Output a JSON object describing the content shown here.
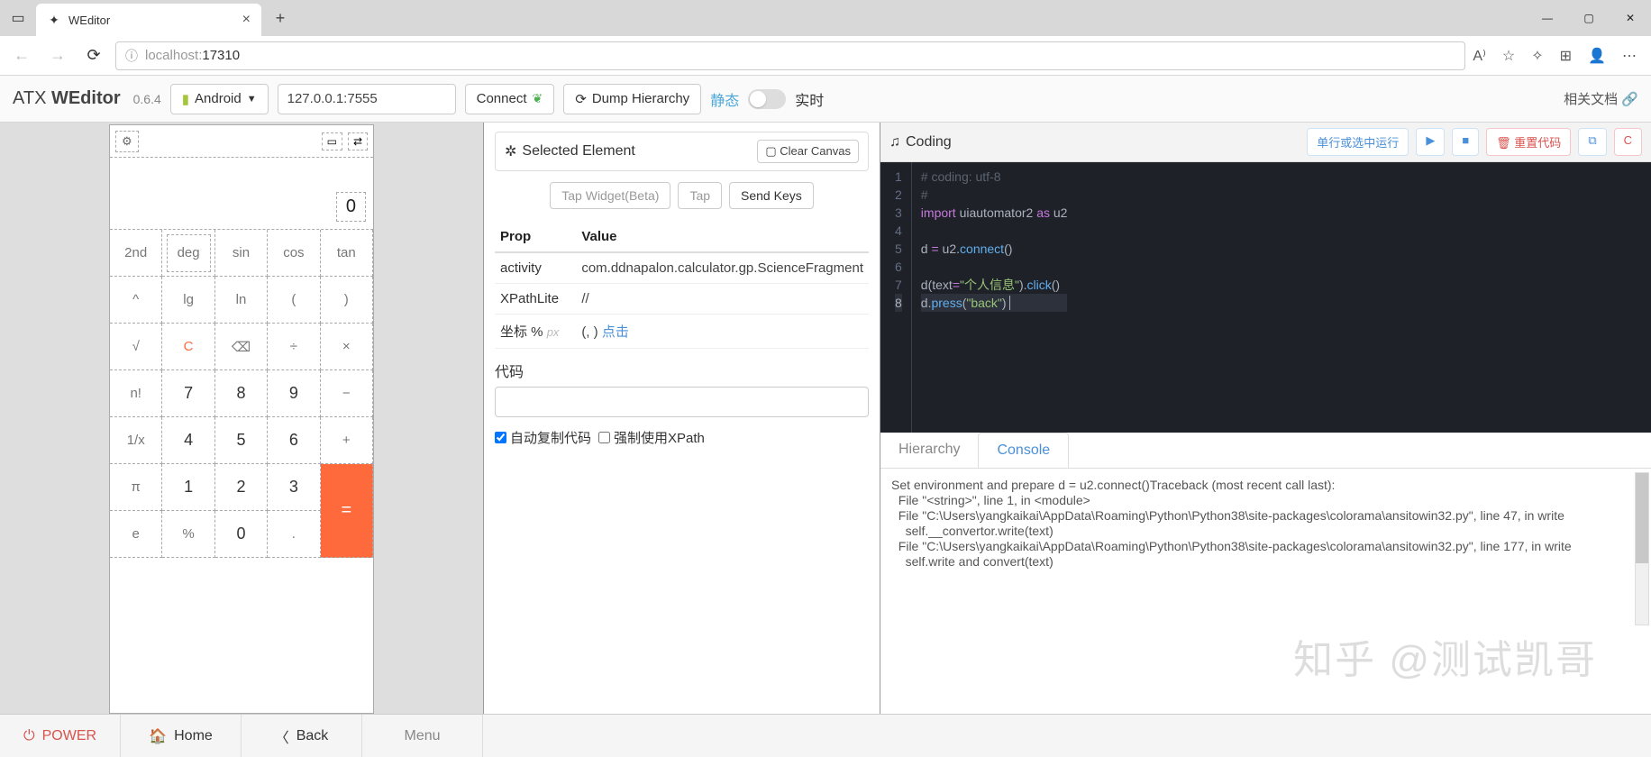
{
  "browser": {
    "tab_title": "WEditor",
    "url_host": "localhost:",
    "url_port": "17310"
  },
  "app": {
    "name_prefix": "ATX ",
    "name_bold": "WEditor",
    "version": "0.6.4",
    "platform": "Android",
    "ip": "127.0.0.1:7555",
    "connect": "Connect",
    "dump": "Dump Hierarchy",
    "static": "静态",
    "realtime": "实时",
    "docs": "相关文档"
  },
  "phone": {
    "display": "0",
    "keys": [
      "2nd",
      "deg",
      "sin",
      "cos",
      "tan",
      "^",
      "lg",
      "ln",
      "(",
      ")",
      "√",
      "C",
      "⌫",
      "÷",
      "×",
      "n!",
      "7",
      "8",
      "9",
      "−",
      "1/x",
      "4",
      "5",
      "6",
      "+",
      "π",
      "1",
      "2",
      "3",
      "=",
      "e",
      "%",
      "0",
      "."
    ]
  },
  "inspector": {
    "title": "Selected Element",
    "clear": "Clear Canvas",
    "actions": {
      "tap_widget": "Tap Widget(Beta)",
      "tap": "Tap",
      "send_keys": "Send Keys"
    },
    "th_prop": "Prop",
    "th_value": "Value",
    "rows": [
      {
        "prop": "activity",
        "value": "com.ddnapalon.calculator.gp.ScienceFragment"
      },
      {
        "prop": "XPathLite",
        "value": "//"
      },
      {
        "prop": "坐标 %",
        "unit": "px",
        "value": "(, )",
        "link": "点击"
      }
    ],
    "code_label": "代码",
    "chk_auto": "自动复制代码",
    "chk_xpath": "强制使用XPath"
  },
  "coding": {
    "title": "Coding",
    "btn_run": "单行或选中运行",
    "btn_reset": "重置代码",
    "tabs": {
      "hierarchy": "Hierarchy",
      "console": "Console"
    },
    "code": {
      "l1": "# coding: utf-8",
      "l2": "#",
      "l3a": "import",
      "l3b": " uiautomator2 ",
      "l3c": "as",
      "l3d": " u2",
      "l5a": "d ",
      "l5b": "=",
      "l5c": " u2.",
      "l5d": "connect",
      "l5e": "()",
      "l7a": "d(text",
      "l7b": "=",
      "l7c": "\"个人信息\"",
      "l7d": ").",
      "l7e": "click",
      "l7f": "()",
      "l8a": "d.",
      "l8b": "press",
      "l8c": "(",
      "l8d": "\"back\"",
      "l8e": ")"
    },
    "console_text": "Set environment and prepare d = u2.connect()Traceback (most recent call last):\n  File \"<string>\", line 1, in <module>\n  File \"C:\\Users\\yangkaikai\\AppData\\Roaming\\Python\\Python38\\site-packages\\colorama\\ansitowin32.py\", line 47, in write\n    self.__convertor.write(text)\n  File \"C:\\Users\\yangkaikai\\AppData\\Roaming\\Python\\Python38\\site-packages\\colorama\\ansitowin32.py\", line 177, in write\n    self.write and convert(text)"
  },
  "bottom": {
    "power": "POWER",
    "home": "Home",
    "back": "Back",
    "menu": "Menu"
  },
  "watermark": "知乎 @测试凯哥"
}
